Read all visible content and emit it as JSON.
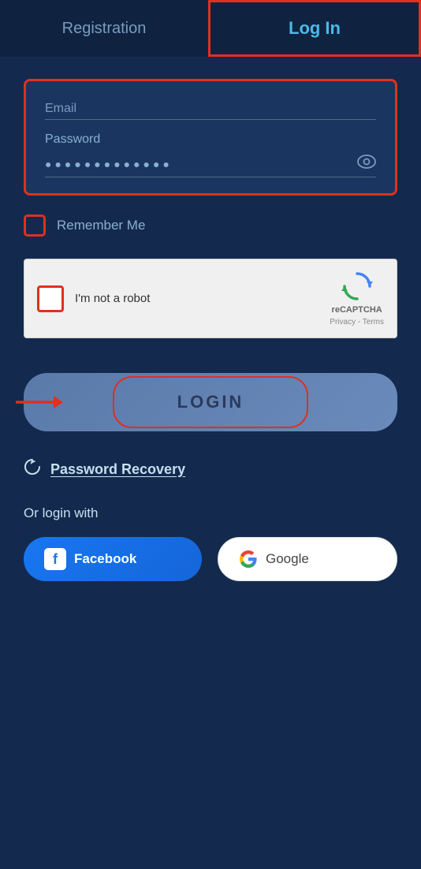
{
  "tabs": {
    "registration_label": "Registration",
    "login_label": "Log In"
  },
  "form": {
    "email_placeholder": "Email",
    "password_label": "Password",
    "password_value": "●●●●●●●●●●●●●",
    "remember_label": "Remember Me"
  },
  "recaptcha": {
    "text": "I'm not a robot",
    "brand": "reCAPTCHA",
    "links": "Privacy - Terms"
  },
  "login_button": {
    "label": "LOGIN"
  },
  "password_recovery": {
    "label": "Password Recovery"
  },
  "social": {
    "or_label": "Or login with",
    "facebook_label": "Facebook",
    "google_label": "Google"
  },
  "colors": {
    "background": "#132a4e",
    "tab_bar": "#0f2340",
    "accent_red": "#e03020",
    "accent_blue": "#4db8e8",
    "text_muted": "#8ab0d0"
  }
}
